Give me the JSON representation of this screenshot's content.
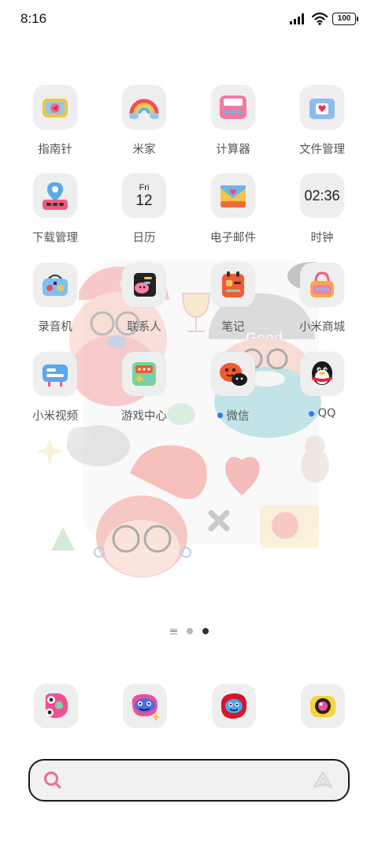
{
  "status_bar": {
    "time": "8:16",
    "battery": "100",
    "icons": [
      "signal-icon",
      "wifi-icon",
      "battery-icon"
    ]
  },
  "apps": [
    {
      "label": "指南针",
      "icon": "compass-icon"
    },
    {
      "label": "米家",
      "icon": "rainbow-home-icon"
    },
    {
      "label": "计算器",
      "icon": "calculator-icon"
    },
    {
      "label": "文件管理",
      "icon": "folder-icon"
    },
    {
      "label": "下载管理",
      "icon": "download-icon"
    },
    {
      "label": "日历",
      "icon": "calendar-icon",
      "weekday": "Fri",
      "day": "12"
    },
    {
      "label": "电子邮件",
      "icon": "mail-icon"
    },
    {
      "label": "时钟",
      "icon": "clock-icon",
      "time": "02:36"
    },
    {
      "label": "录音机",
      "icon": "recorder-icon"
    },
    {
      "label": "联系人",
      "icon": "contacts-icon"
    },
    {
      "label": "笔记",
      "icon": "notes-icon"
    },
    {
      "label": "小米商城",
      "icon": "shopping-bag-icon"
    },
    {
      "label": "小米视频",
      "icon": "video-icon"
    },
    {
      "label": "游戏中心",
      "icon": "game-icon"
    },
    {
      "label": "微信",
      "icon": "wechat-icon",
      "badge": true
    },
    {
      "label": "QQ",
      "icon": "qq-penguin-icon",
      "badge": true
    }
  ],
  "dock": [
    {
      "icon": "phone-face-icon"
    },
    {
      "icon": "messages-face-icon"
    },
    {
      "icon": "browser-face-icon"
    },
    {
      "icon": "camera-icon"
    }
  ],
  "search": {
    "placeholder": "",
    "icons": [
      "search-icon",
      "assistant-icon"
    ]
  },
  "wallpaper": {
    "text": "Good"
  },
  "colors": {
    "accent_dot": "#2a7df5",
    "search_icon": "#f06aa0",
    "icon_bg": "#eeeeee"
  }
}
